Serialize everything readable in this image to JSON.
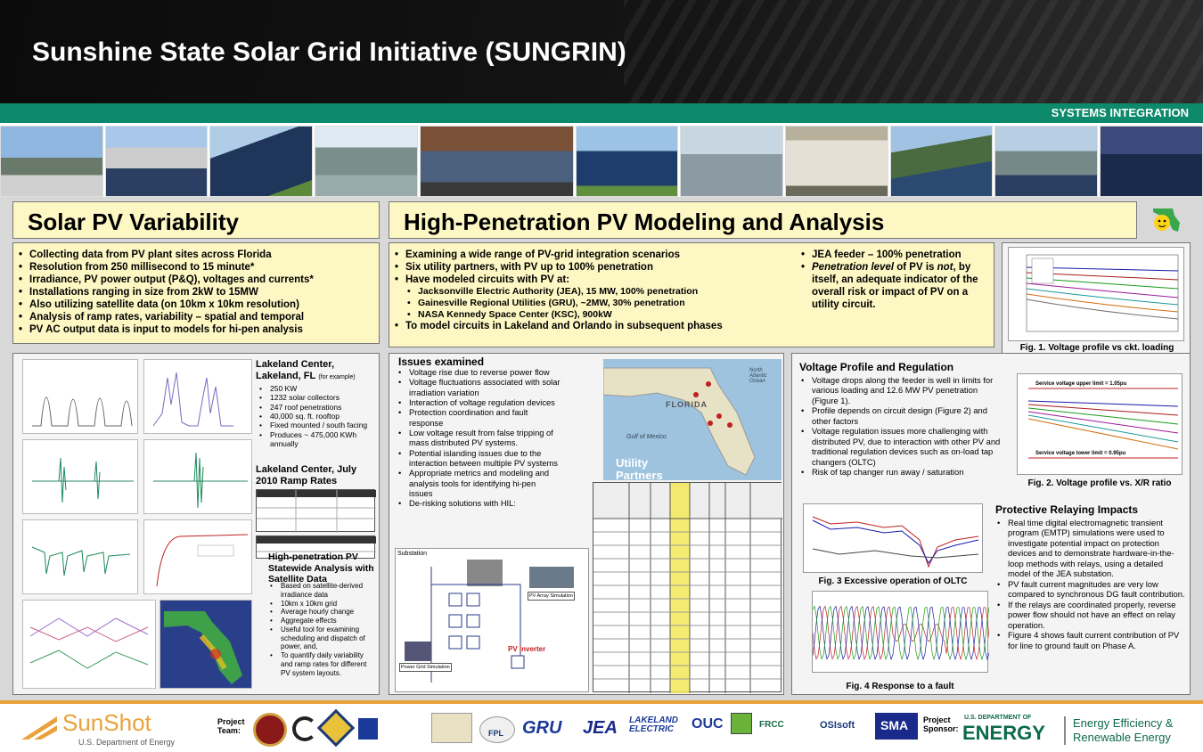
{
  "header": {
    "title": "Sunshine State Solar Grid Initiative (SUNGRIN)",
    "subtitle": "SYSTEMS INTEGRATION"
  },
  "sections": {
    "variability": {
      "title": "Solar PV Variability",
      "bullets": [
        "Collecting data from PV plant sites across Florida",
        "Resolution from 250 millisecond to 15 minute*",
        "Irradiance, PV power output (P&Q), voltages and currents*",
        "Installations ranging in size from 2kW to 15MW",
        "Also utilizing satellite data (on 10km x 10km resolution)",
        "Analysis of ramp rates, variability – spatial and temporal",
        "PV AC output data is input to models for hi-pen analysis"
      ]
    },
    "modeling": {
      "title": "High-Penetration PV Modeling and Analysis",
      "bullets": [
        "Examining a wide range of PV-grid integration scenarios",
        "Six utility partners, with PV up to 100% penetration",
        "Have modeled circuits with PV at:"
      ],
      "sub_bullets": [
        "Jacksonville Electric Authority (JEA), 15 MW, 100% penetration",
        "Gainesville Regional Utilities (GRU), ~2MW, 30% penetration",
        "NASA Kennedy Space Center (KSC), 900kW"
      ],
      "last_bullet": "To model circuits in Lakeland and Orlando in subsequent phases",
      "right_bullet_1": "JEA feeder – 100% penetration",
      "right_bullet_2_em": "Penetration level",
      "right_bullet_2_a": " of PV is ",
      "right_bullet_2_not": "not",
      "right_bullet_2_b": ", by itself, an adequate indicator of the overall risk or impact of PV on a utility circuit."
    },
    "lakeland": {
      "title": "Lakeland Center,",
      "subtitle": "Lakeland, FL",
      "note": "(for example)",
      "bullets": [
        "250 KW",
        "1232 solar collectors",
        "247 roof penetrations",
        "40,000 sq. ft. rooftop",
        "Fixed mounted / south facing",
        "Produces ~ 475,000 KWh annually"
      ],
      "ramp_title": "Lakeland Center, July 2010 Ramp Rates",
      "sat_title": "High-penetration PV Statewide Analysis with Satellite Data",
      "sat_bullets": [
        "Based on satellite-derived irradiance data",
        "10km x 10km grid",
        "Average hourly change",
        "Aggregate effects",
        "Useful tool for examining scheduling and dispatch of power, and,",
        "To quantify daily variability and ramp rates for different PV system layouts."
      ]
    },
    "issues": {
      "title": "Issues examined",
      "bullets": [
        "Voltage rise due to reverse power flow",
        "Voltage fluctuations associated with solar irradiation variation",
        "Interaction of voltage regulation devices",
        "Protection coordination and fault response",
        "Low voltage result from false tripping of mass distributed PV systems.",
        "Potential islanding issues due to the interaction between multiple PV systems",
        "Appropriate metrics and modeling and analysis tools for identifying hi-pen issues",
        "De-risking solutions with HIL:"
      ],
      "map_label": "FLORIDA",
      "map_gulf": "Gulf of Mexico",
      "map_ocean": "North Atlantic Ocean",
      "partners_label": "Utility Partners",
      "diagram_substation": "Substation",
      "diagram_pv": "PV Inverter",
      "diagram_power": "Power Grid Simulation",
      "diagram_array": "PV Array Simulation"
    },
    "voltage": {
      "title": "Voltage Profile and Regulation",
      "bullets": [
        "Voltage drops along the feeder is well in limits for various loading and 12.6 MW PV penetration (Figure 1).",
        "Profile depends on circuit design (Figure 2) and other factors",
        "Voltage regulation issues more challenging with distributed PV, due to interaction with other PV and traditional regulation devices such as on-load tap changers (OLTC)",
        "Risk of tap changer run away / saturation"
      ],
      "fig1": "Fig. 1. Voltage profile vs ckt. loading",
      "fig2": "Fig. 2. Voltage profile vs. X/R ratio",
      "fig2_upper": "Service voltage upper limit = 1.05pu",
      "fig2_lower": "Service voltage lower limit = 0.95pu",
      "fig3": "Fig. 3 Excessive operation of OLTC",
      "fig4": "Fig. 4 Response to a fault"
    },
    "relaying": {
      "title": "Protective Relaying Impacts",
      "bullets": [
        "Real time digital electromagnetic transient program (EMTP) simulations were used to investigate potential impact on protection devices and to demonstrate hardware-in-the-loop methods with relays, using a detailed model of the JEA substation.",
        "PV fault current magnitudes are very low compared to synchronous DG fault contribution.",
        "If the relays are coordinated properly, reverse power flow should not have an effect on relay operation.",
        "Figure 4 shows fault current contribution of PV for line to ground fault on Phase A."
      ]
    }
  },
  "footer": {
    "sunshot": "SunShot",
    "sunshot_sub": "U.S. Department of Energy",
    "project_team": "Project Team:",
    "project_sponsor": "Project Sponsor:",
    "partners": [
      "GRU",
      "JEA",
      "LAKELAND ELECTRIC",
      "OUC",
      "FPL",
      "FRCC",
      "OSIsoft",
      "SMA"
    ],
    "doe_top": "U.S. DEPARTMENT OF",
    "doe_energy": "ENERGY",
    "eere_1": "Energy Efficiency &",
    "eere_2": "Renewable Energy"
  },
  "colors": {
    "header": "#111111",
    "green": "#0d8a6b",
    "yellow": "#fdf7c3",
    "orange": "#e9a23b"
  }
}
